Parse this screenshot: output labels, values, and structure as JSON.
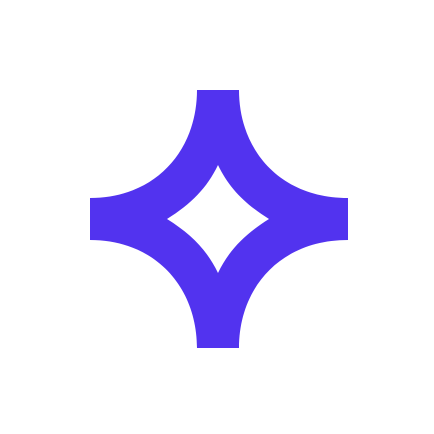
{
  "logo": {
    "icon": "four-point-star-outline-icon",
    "color": "#5233ef",
    "background": "#ffffff"
  }
}
